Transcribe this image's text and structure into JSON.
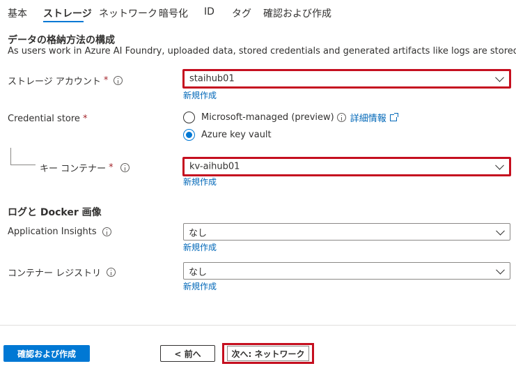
{
  "tabs": [
    {
      "label": "基本"
    },
    {
      "label": "ストレージ",
      "active": true
    },
    {
      "label": "ネットワーク"
    },
    {
      "label": "暗号化"
    },
    {
      "label": "ID"
    },
    {
      "label": "タグ"
    },
    {
      "label": "確認および作成"
    }
  ],
  "storage_section": {
    "title": "データの格納方法の構成",
    "description": "As users work in Azure AI Foundry, uploaded data, stored credentials and generated artifacts like logs are stored."
  },
  "storage_account": {
    "label": "ストレージ アカウント",
    "required_mark": "*",
    "value": "staihub01",
    "create_new": "新規作成"
  },
  "credential_store": {
    "label": "Credential store",
    "required_mark": "*",
    "options": [
      {
        "label": "Microsoft-managed (preview)",
        "checked": false
      },
      {
        "label": "Azure key vault",
        "checked": true
      }
    ],
    "more_info": "詳細情報"
  },
  "key_container": {
    "label": "キー コンテナー",
    "required_mark": "*",
    "value": "kv-aihub01",
    "create_new": "新規作成"
  },
  "logs_section": {
    "title": "ログと Docker 画像"
  },
  "app_insights": {
    "label": "Application Insights",
    "value": "なし",
    "create_new": "新規作成"
  },
  "container_registry": {
    "label": "コンテナー レジストリ",
    "value": "なし",
    "create_new": "新規作成"
  },
  "footer": {
    "review_create": "確認および作成",
    "previous": "< 前へ",
    "next": "次へ: ネットワーク"
  },
  "colors": {
    "accent": "#0078d4",
    "link": "#0067b8",
    "highlight": "#c50f1f",
    "required": "#a4262c"
  }
}
